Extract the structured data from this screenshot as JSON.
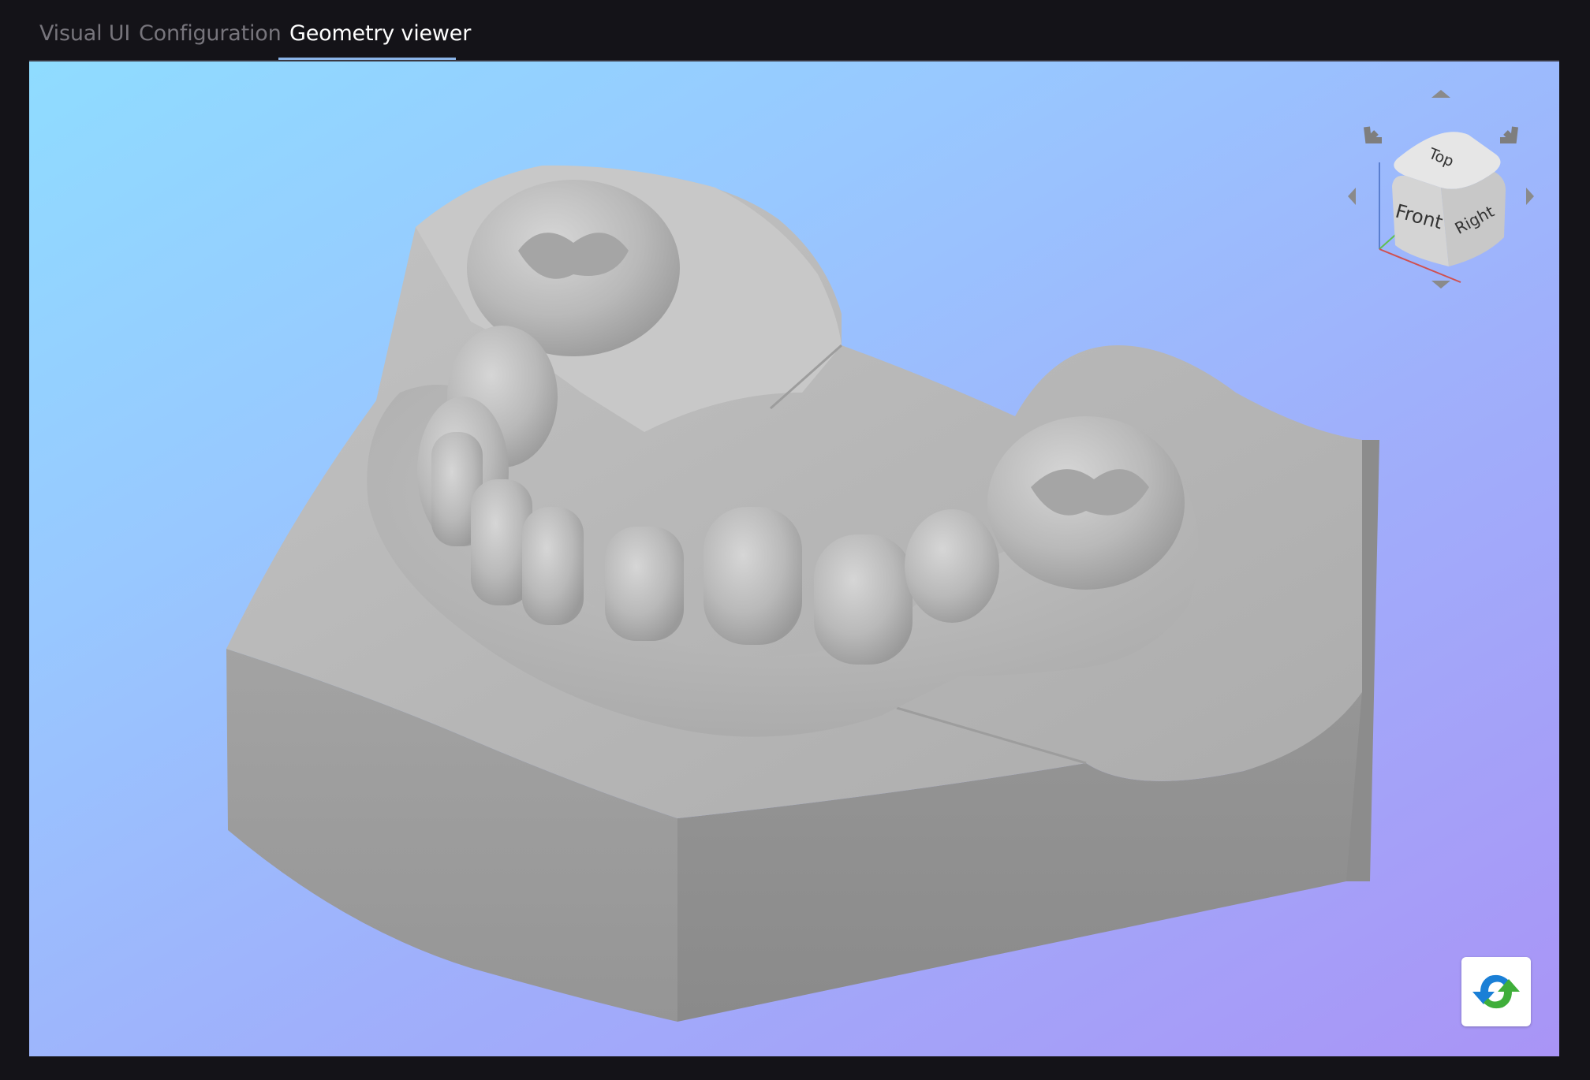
{
  "tabs": [
    {
      "label": "Visual UI",
      "active": false
    },
    {
      "label": "Configuration",
      "active": false
    },
    {
      "label": "Geometry viewer",
      "active": true
    }
  ],
  "viewer": {
    "model_name": "dental-cast-model",
    "navcube": {
      "faces": {
        "top": "Top",
        "front": "Front",
        "right": "Right"
      }
    },
    "reset_icon": "sync-icon"
  },
  "colors": {
    "background_dark": "#141318",
    "tab_inactive": "#77757c",
    "tab_active": "#ffffff",
    "tab_underline": "#8ab4e8",
    "viewport_gradient_start": "#8fdcff",
    "viewport_gradient_end": "#a994f6",
    "model_gray": "#a9a9a9",
    "reset_blue": "#1a7fd6",
    "reset_green": "#3fae3a"
  }
}
